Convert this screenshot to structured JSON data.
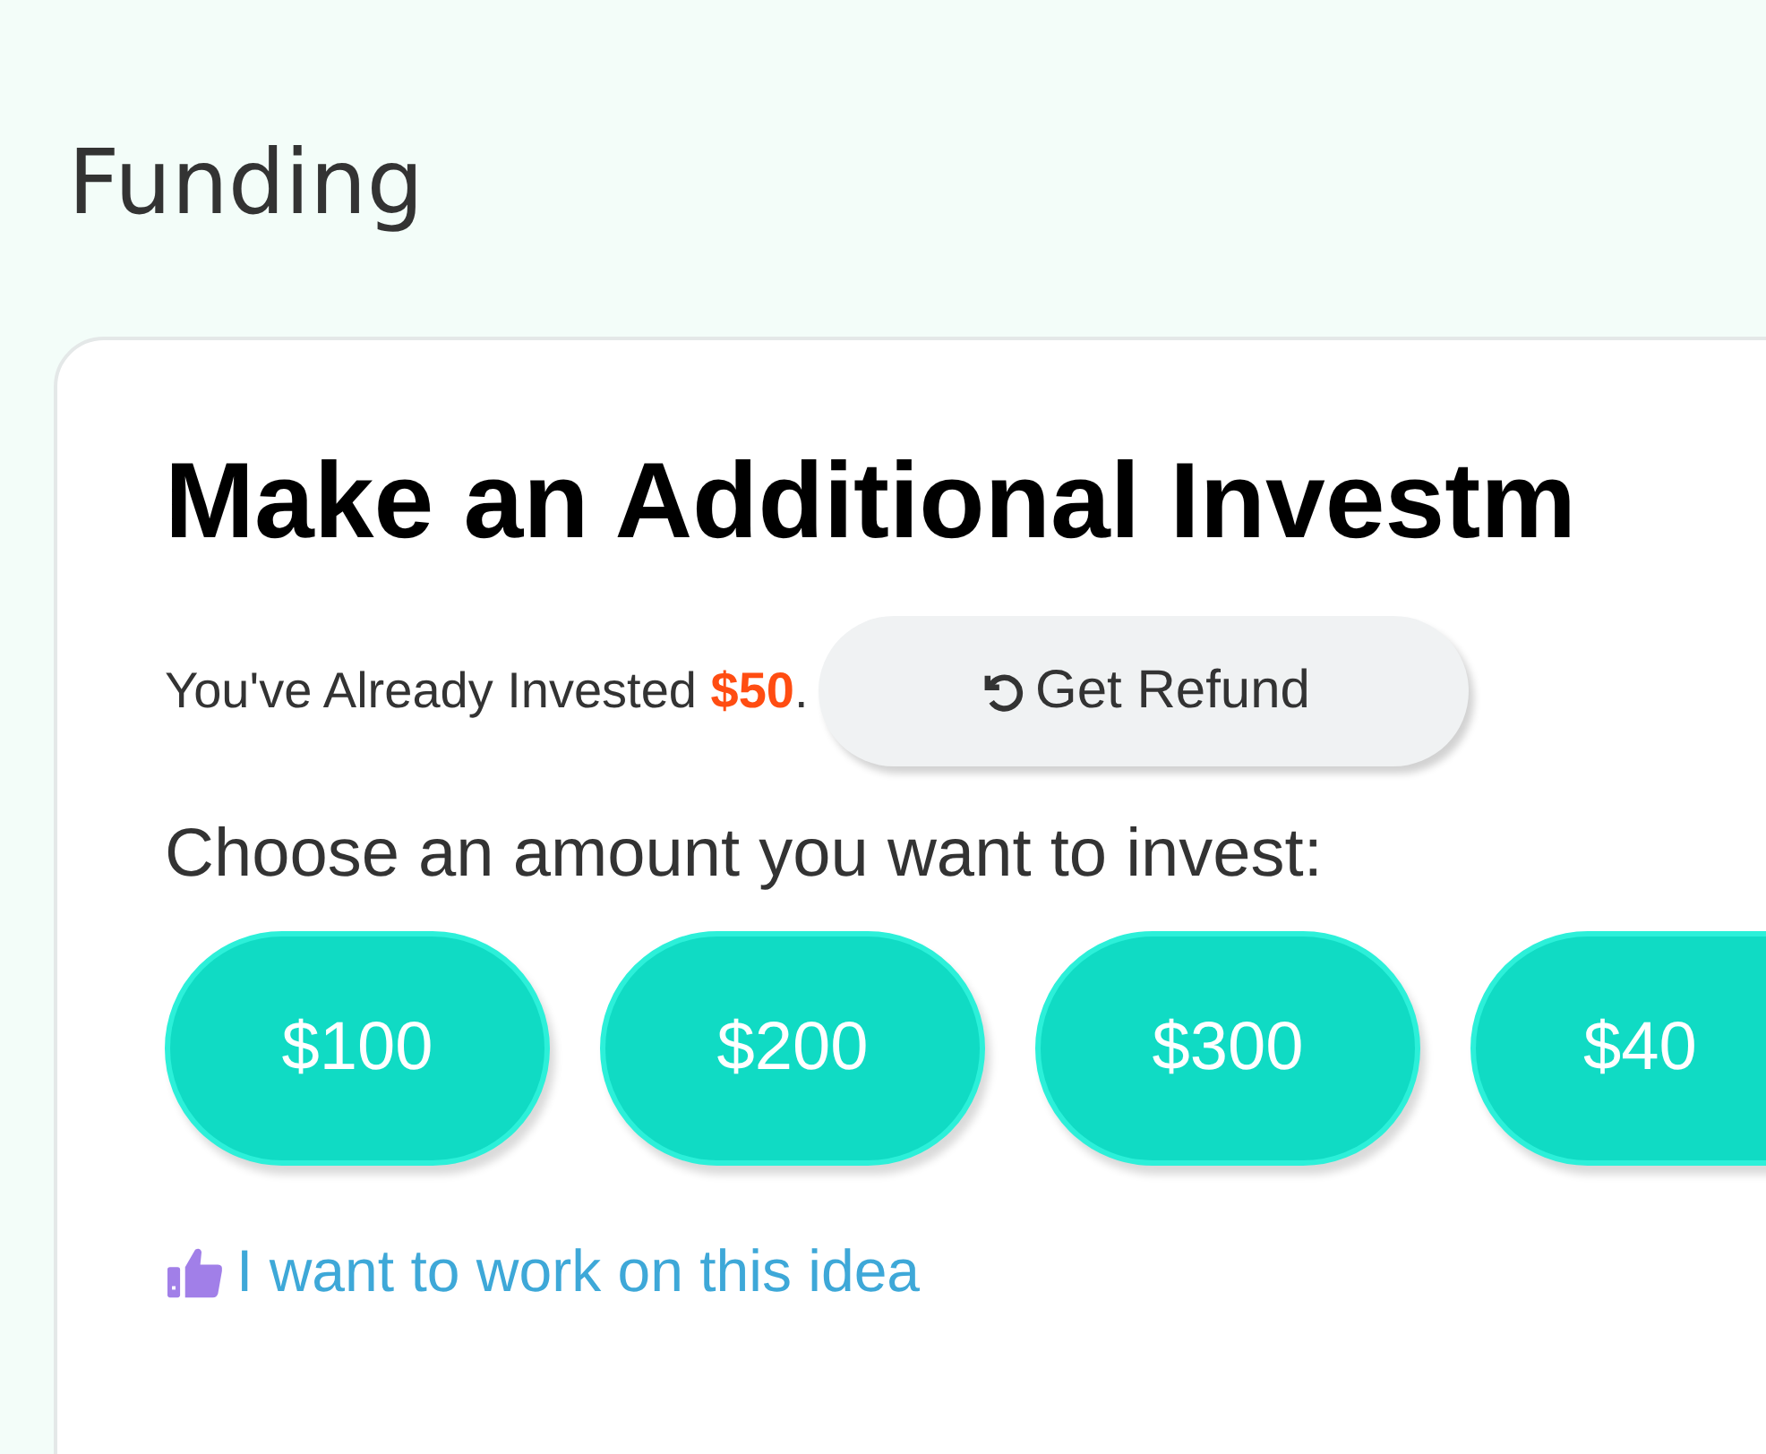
{
  "page_title": "Funding",
  "card": {
    "title": "Make an Additional Investm",
    "invested": {
      "text": "You've Already Invested ",
      "amount": "$50",
      "end": "."
    },
    "refund_button": {
      "label": "Get Refund"
    },
    "prompt": "Choose an amount you want to invest:",
    "amounts": [
      {
        "label": "$100"
      },
      {
        "label": "$200"
      },
      {
        "label": "$300"
      },
      {
        "label": "$40"
      }
    ],
    "link": {
      "label": "I want to work on this idea"
    }
  }
}
